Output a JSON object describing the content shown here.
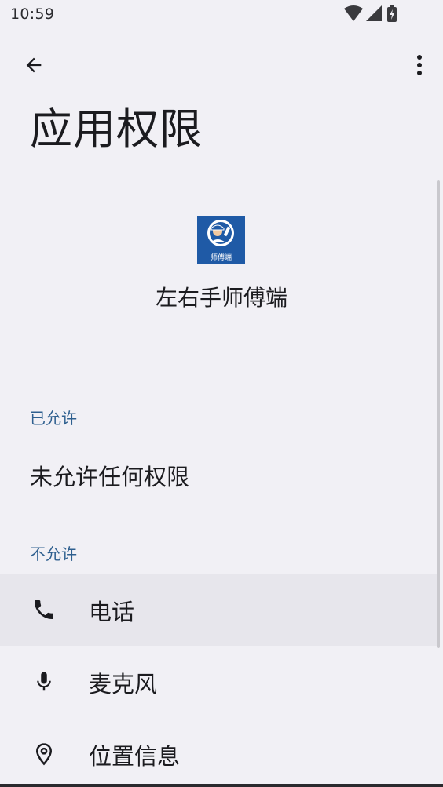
{
  "status_bar": {
    "time": "10:59",
    "icons": [
      "wifi-icon",
      "cell-signal-icon",
      "battery-charging-icon"
    ]
  },
  "app_bar": {
    "back_icon": "arrow-back-icon",
    "more_icon": "more-vert-icon"
  },
  "page": {
    "title": "应用权限"
  },
  "app": {
    "name": "左右手师傅端",
    "icon_badge_text": "师傅端"
  },
  "sections": {
    "allowed_header": "已允许",
    "allowed_empty_text": "未允许任何权限",
    "denied_header": "不允许"
  },
  "permissions": [
    {
      "label": "电话",
      "icon": "phone-icon"
    },
    {
      "label": "麦克风",
      "icon": "mic-icon"
    },
    {
      "label": "位置信息",
      "icon": "location-pin-icon"
    }
  ],
  "colors": {
    "background": "#f1f0f5",
    "section_header": "#2e5f8f",
    "highlight_row": "#e7e6ec",
    "app_icon_blue": "#1f5aa6"
  }
}
